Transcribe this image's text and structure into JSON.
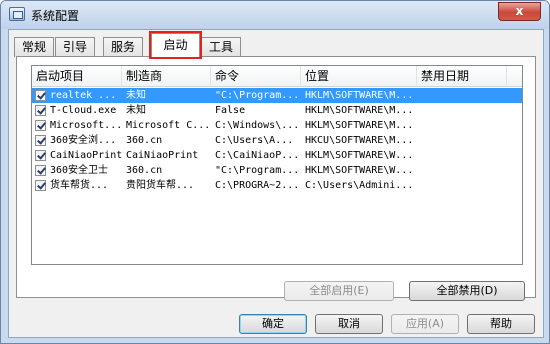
{
  "window": {
    "title": "系统配置",
    "close_label": "x"
  },
  "tabs": [
    {
      "label": "常规"
    },
    {
      "label": "引导"
    },
    {
      "label": "服务"
    },
    {
      "label": "启动",
      "active": true
    },
    {
      "label": "工具"
    }
  ],
  "startup_list": {
    "columns": [
      "启动项目",
      "制造商",
      "命令",
      "位置",
      "禁用日期"
    ],
    "rows": [
      {
        "checked": true,
        "item": "realtek ...",
        "maker": "未知",
        "command": "\"C:\\Program...",
        "location": "HKLM\\SOFTWARE\\M...",
        "disabled_date": "",
        "selected": true
      },
      {
        "checked": true,
        "item": "T-Cloud.exe",
        "maker": "未知",
        "command": "False",
        "location": "HKLM\\SOFTWARE\\M...",
        "disabled_date": ""
      },
      {
        "checked": true,
        "item": "Microsoft...",
        "maker": "Microsoft C...",
        "command": "C:\\Windows\\...",
        "location": "HKLM\\SOFTWARE\\M...",
        "disabled_date": ""
      },
      {
        "checked": true,
        "item": "360安全浏...",
        "maker": "360.cn",
        "command": "C:\\Users\\A...",
        "location": "HKCU\\SOFTWARE\\M...",
        "disabled_date": ""
      },
      {
        "checked": true,
        "item": "CaiNiaoPrint",
        "maker": "CaiNiaoPrint",
        "command": "C:\\CaiNiaoP...",
        "location": "HKLM\\SOFTWARE\\W...",
        "disabled_date": ""
      },
      {
        "checked": true,
        "item": "360安全卫士",
        "maker": "360.cn",
        "command": "\"C:\\Program...",
        "location": "HKLM\\SOFTWARE\\W...",
        "disabled_date": ""
      },
      {
        "checked": true,
        "item": "货车帮货...",
        "maker": "贵阳货车帮...",
        "command": "C:\\PROGRA~2...",
        "location": "C:\\Users\\Admini...",
        "disabled_date": ""
      }
    ]
  },
  "panel_buttons": {
    "enable_all": "全部启用(E)",
    "disable_all": "全部禁用(D)"
  },
  "dialog_buttons": {
    "ok": "确定",
    "cancel": "取消",
    "apply": "应用(A)",
    "help": "帮助"
  }
}
